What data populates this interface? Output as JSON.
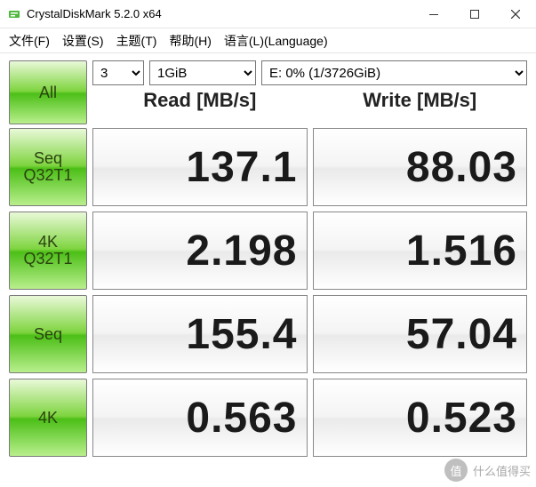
{
  "window": {
    "title": "CrystalDiskMark 5.2.0 x64"
  },
  "menu": {
    "file": "文件(F)",
    "settings": "设置(S)",
    "theme": "主题(T)",
    "help": "帮助(H)",
    "language": "语言(L)(Language)"
  },
  "controls": {
    "runs": "3",
    "size": "1GiB",
    "drive": "E: 0% (1/3726GiB)"
  },
  "buttons": {
    "all": "All",
    "seq_q32t1_l1": "Seq",
    "seq_q32t1_l2": "Q32T1",
    "4k_q32t1_l1": "4K",
    "4k_q32t1_l2": "Q32T1",
    "seq": "Seq",
    "fourk": "4K"
  },
  "headers": {
    "read": "Read [MB/s]",
    "write": "Write [MB/s]"
  },
  "chart_data": {
    "type": "table",
    "title": "CrystalDiskMark 5.2.0 x64",
    "columns": [
      "Read [MB/s]",
      "Write [MB/s]"
    ],
    "rows": [
      {
        "test": "Seq Q32T1",
        "read": 137.1,
        "write": 88.03
      },
      {
        "test": "4K Q32T1",
        "read": 2.198,
        "write": 1.516
      },
      {
        "test": "Seq",
        "read": 155.4,
        "write": 57.04
      },
      {
        "test": "4K",
        "read": 0.563,
        "write": 0.523
      }
    ]
  },
  "results": {
    "r0_read": "137.1",
    "r0_write": "88.03",
    "r1_read": "2.198",
    "r1_write": "1.516",
    "r2_read": "155.4",
    "r2_write": "57.04",
    "r3_read": "0.563",
    "r3_write": "0.523"
  },
  "watermark": {
    "icon": "值",
    "text": "什么值得买"
  }
}
